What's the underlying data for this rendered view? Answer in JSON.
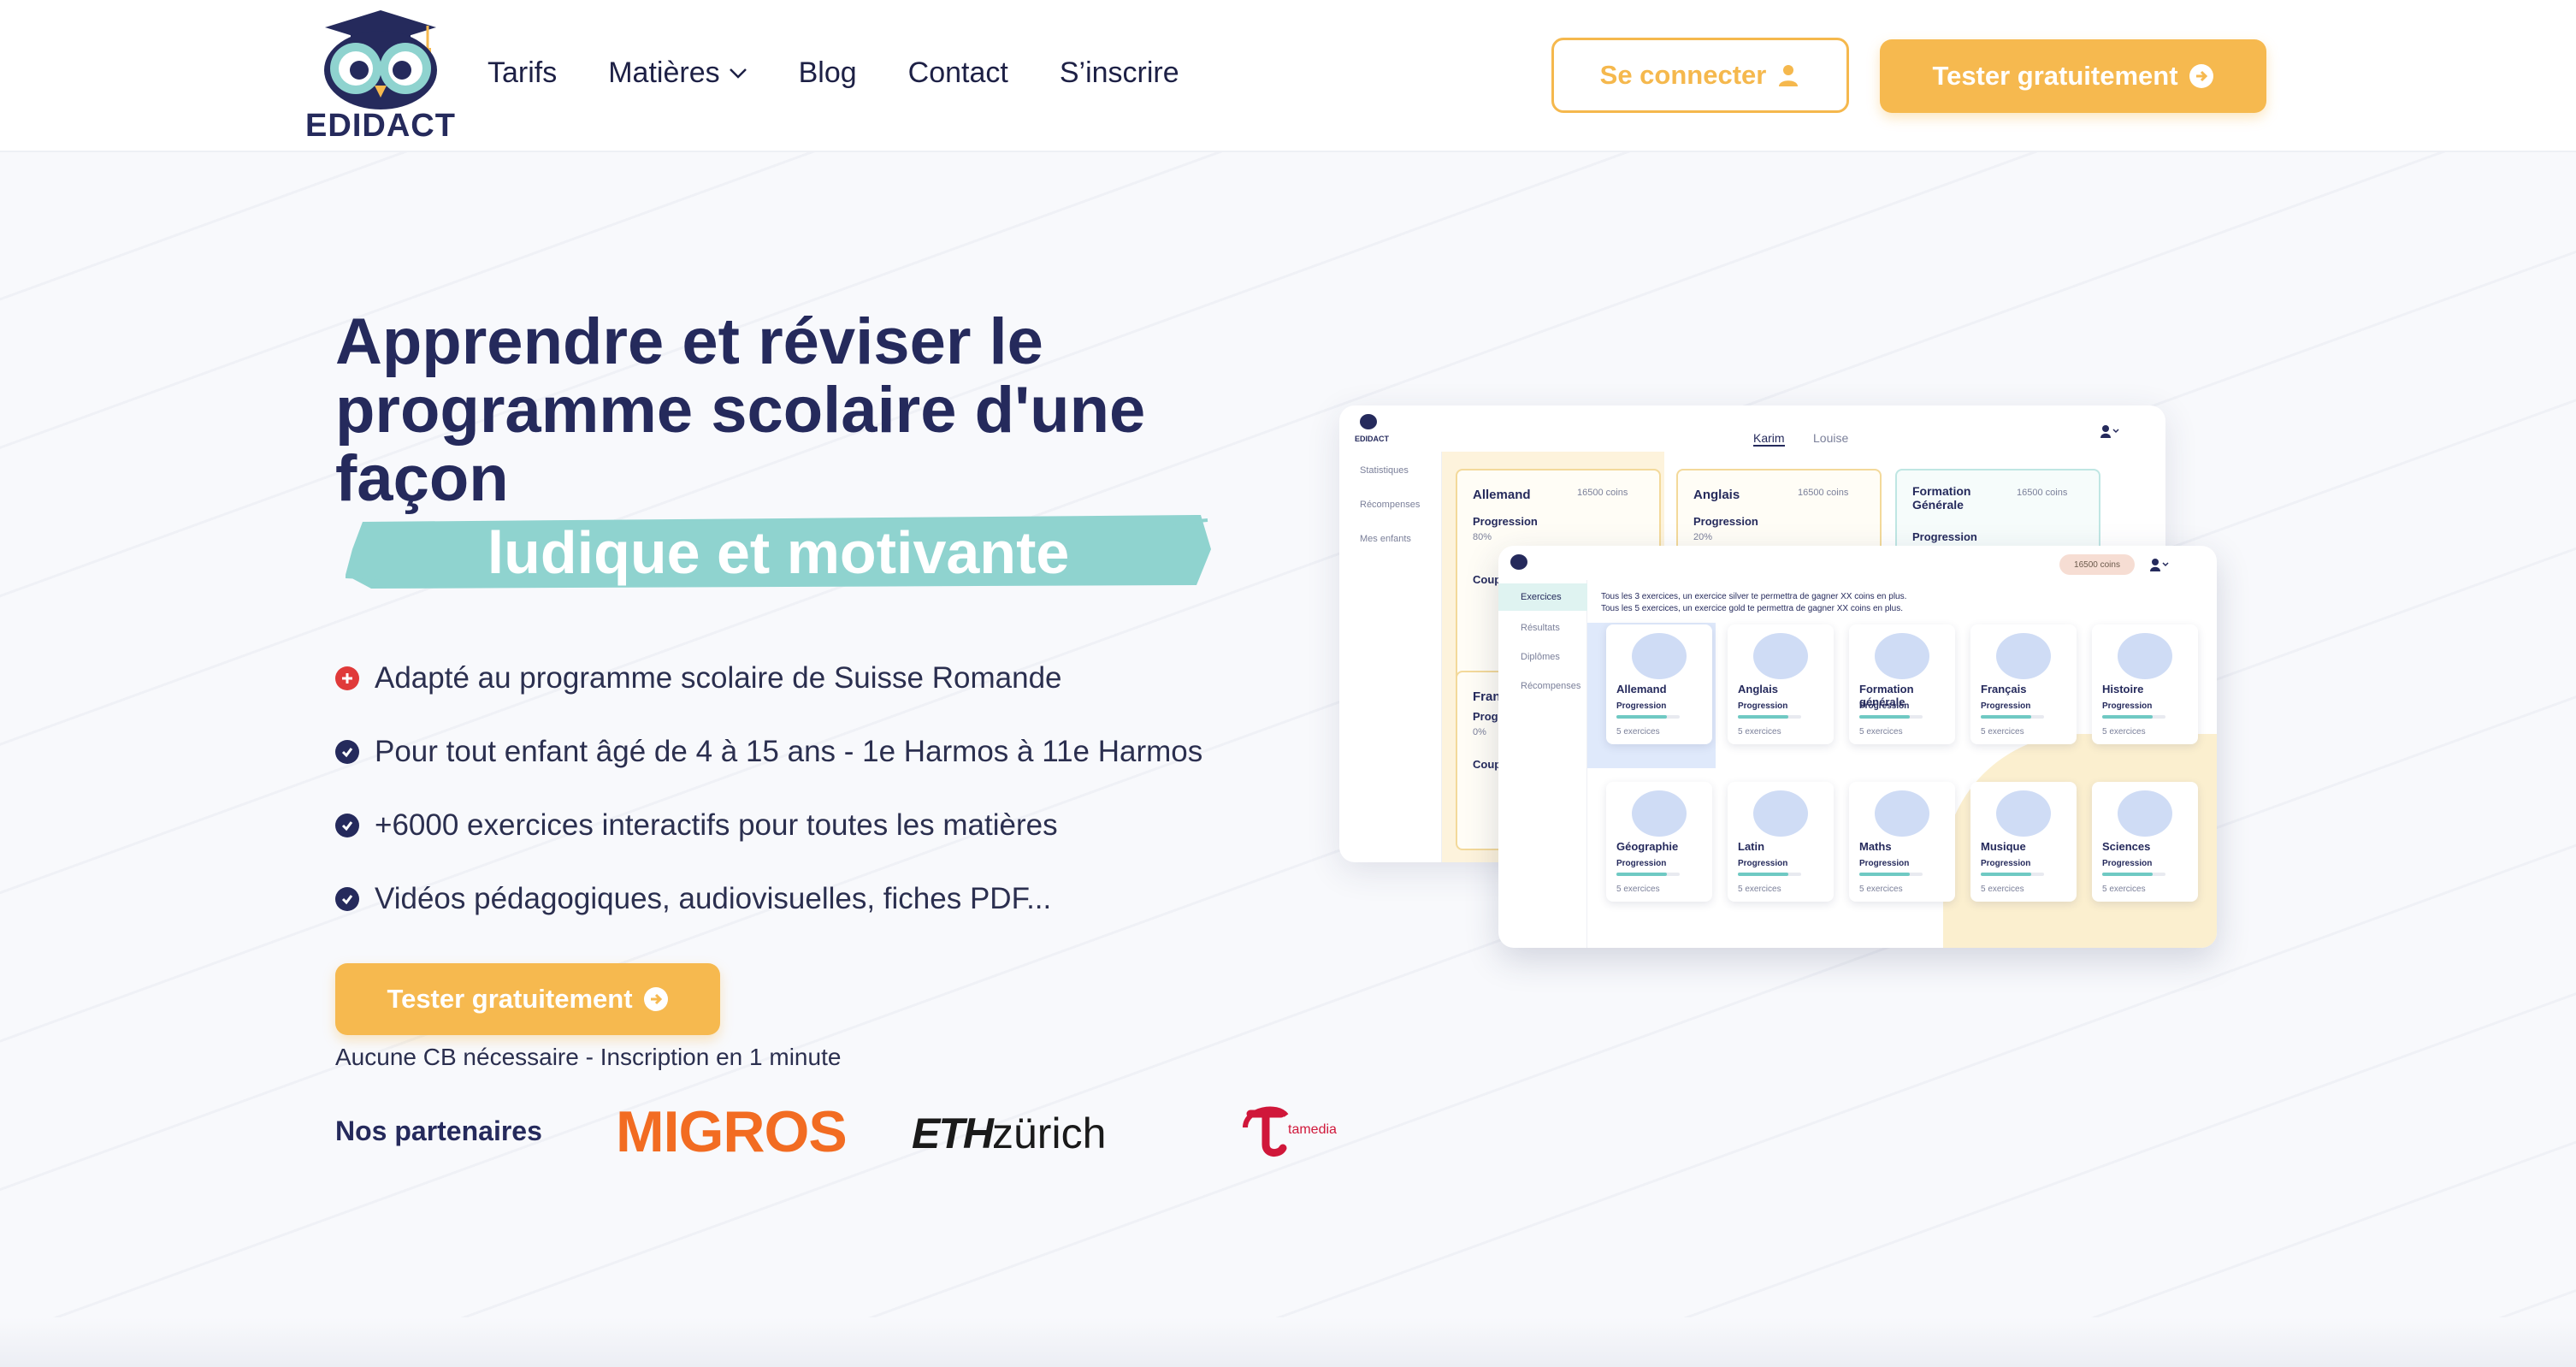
{
  "brand": {
    "name": "EDIDACT"
  },
  "nav": {
    "items": [
      "Tarifs",
      "Matières",
      "Blog",
      "Contact",
      "S’inscrire"
    ]
  },
  "header": {
    "login_label": "Se connecter",
    "trial_label": "Tester gratuitement"
  },
  "hero": {
    "title": "Apprendre et réviser le programme scolaire d'une façon",
    "highlight": "ludique et motivante",
    "features": [
      {
        "text": "Adapté au programme scolaire de Suisse Romande",
        "icon": "plus-circle-icon",
        "color": "#e03a3a"
      },
      {
        "text": "Pour tout enfant âgé de 4 à 15 ans - 1e Harmos à 11e Harmos",
        "icon": "check-circle-icon",
        "color": "#252a5c"
      },
      {
        "text": "+6000 exercices interactifs pour toutes les matières",
        "icon": "check-circle-icon",
        "color": "#252a5c"
      },
      {
        "text": "Vidéos pédagogiques, audiovisuelles, fiches PDF...",
        "icon": "check-circle-icon",
        "color": "#252a5c"
      }
    ],
    "cta_label": "Tester gratuitement",
    "note": "Aucune CB nécessaire - Inscription en 1 minute"
  },
  "partners": {
    "label": "Nos partenaires",
    "items": [
      "MIGROS",
      "ETH",
      "zürich",
      "tamedia"
    ]
  },
  "mockup_back": {
    "logo": "EDIDACT",
    "tabs": [
      "Karim",
      "Louise"
    ],
    "menu": [
      "Statistiques",
      "Récompenses",
      "Mes enfants"
    ],
    "cards": [
      {
        "name": "Allemand",
        "coins": "16500 coins",
        "label": "Progression",
        "pct": "80%"
      },
      {
        "name": "Anglais",
        "coins": "16500 coins",
        "label": "Progression",
        "pct": "20%"
      },
      {
        "name": "Formation Générale",
        "coins": "16500 coins",
        "label": "Progression",
        "pct": ""
      }
    ],
    "partials": [
      "Coup",
      "Fran",
      "Prog",
      "0%",
      "Coup"
    ]
  },
  "mockup_front": {
    "coins_badge": "16500 coins",
    "menu": [
      "Exercices",
      "Résultats",
      "Diplômes",
      "Récompenses"
    ],
    "info_line_1": "Tous les 3 exercices, un exercice silver te permettra de gagner XX coins en plus.",
    "info_line_2": "Tous les 5 exercices, un exercice gold te permettra de gagner XX coins en plus.",
    "progress_label": "Progression",
    "progress_pct": "80%",
    "exercises_label": "5 exercices",
    "subjects": [
      "Allemand",
      "Anglais",
      "Formation générale",
      "Français",
      "Histoire",
      "Géographie",
      "Latin",
      "Maths",
      "Musique",
      "Sciences"
    ]
  },
  "colors": {
    "primary": "#252a5c",
    "accent": "#f6b94f",
    "teal": "#8fd3cf",
    "migros": "#f26c22",
    "tamedia": "#d0173a"
  }
}
